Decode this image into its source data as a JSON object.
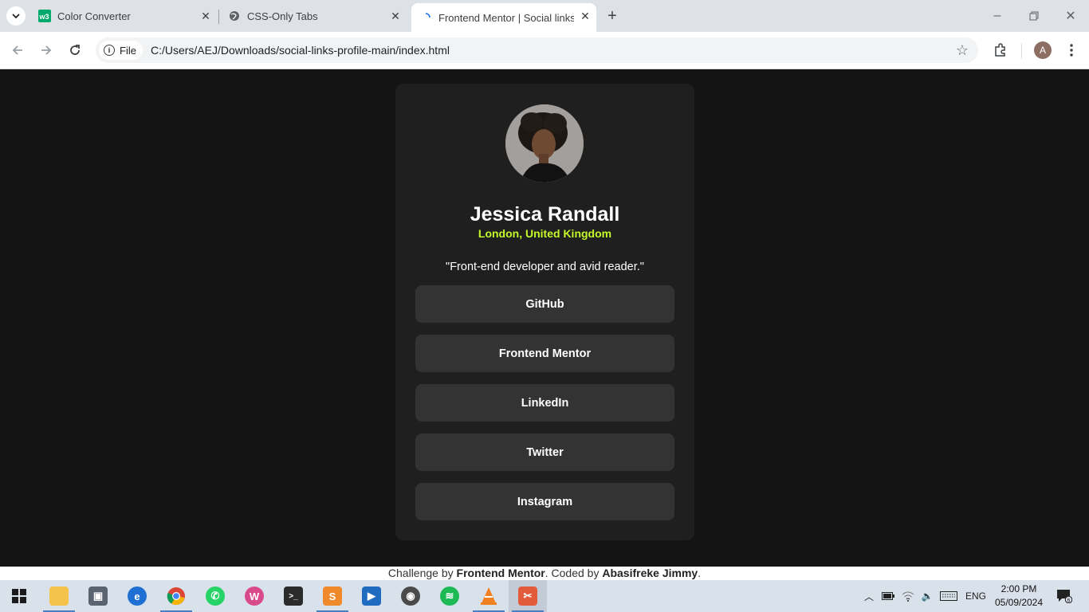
{
  "browser": {
    "tabs": [
      {
        "title": "Color Converter",
        "favicon": "w3schools-icon"
      },
      {
        "title": "CSS-Only Tabs",
        "favicon": "globe-icon"
      },
      {
        "title": "Frontend Mentor | Social links p",
        "favicon": "loading-icon",
        "active": true
      }
    ],
    "omnibox": {
      "scheme_label": "File",
      "url": "C:/Users/AEJ/Downloads/social-links-profile-main/index.html"
    },
    "profile_initial": "A"
  },
  "profile": {
    "name": "Jessica Randall",
    "location": "London, United Kingdom",
    "bio": "\"Front-end developer and avid reader.\"",
    "links": [
      "GitHub",
      "Frontend Mentor",
      "LinkedIn",
      "Twitter",
      "Instagram"
    ]
  },
  "footer": {
    "prefix": "Challenge by ",
    "challenge_by": "Frontend Mentor",
    "middle": ". Coded by ",
    "coded_by": "Abasifreke Jimmy",
    "suffix": "."
  },
  "taskbar": {
    "apps": [
      "start",
      "file-explorer",
      "store",
      "edge",
      "chrome",
      "whatsapp",
      "wps-office",
      "terminal",
      "sublime-text",
      "video-editor",
      "media-player",
      "spotify",
      "vlc",
      "snipping-tool"
    ],
    "tray": {
      "language": "ENG",
      "time": "2:00 PM",
      "date": "05/09/2024",
      "notifications": "6"
    }
  },
  "colors": {
    "page_bg": "#141414",
    "card_bg": "#1f1f1f",
    "button_bg": "#333333",
    "accent_green": "#c4f82a"
  }
}
